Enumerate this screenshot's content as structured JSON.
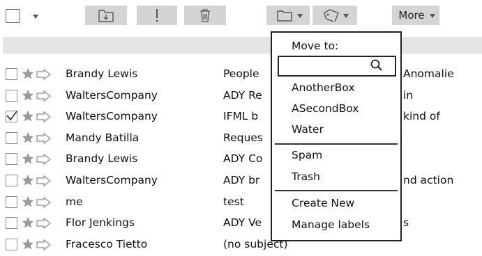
{
  "toolbar": {
    "more_label": "More",
    "icons": [
      "checkbox-icon",
      "move-to-folder-icon",
      "report-spam-icon",
      "trash-icon",
      "folder-icon",
      "label-tag-icon"
    ]
  },
  "move_menu": {
    "title": "Move to:",
    "search_placeholder": "",
    "items": [
      {
        "label": "AnotherBox"
      },
      {
        "label": "ASecondBox"
      },
      {
        "label": "Water"
      },
      {
        "label": "Spam"
      },
      {
        "label": "Trash"
      },
      {
        "label": "Create New"
      },
      {
        "label": "Manage labels"
      }
    ]
  },
  "messages": [
    {
      "sender": "Brandy Lewis",
      "subject": "People",
      "tail": "Anomalie",
      "checked": false
    },
    {
      "sender": "WaltersCompany",
      "subject": "ADY Re",
      "tail": "in",
      "checked": false
    },
    {
      "sender": "WaltersCompany",
      "subject": "IFML b",
      "tail": "kind of",
      "checked": true
    },
    {
      "sender": "Mandy Batilla",
      "subject": "Reques",
      "tail": "",
      "checked": false
    },
    {
      "sender": "Brandy Lewis",
      "subject": "ADY Co",
      "tail": "",
      "checked": false
    },
    {
      "sender": "WaltersCompany",
      "subject": "ADY br",
      "tail": "nd action",
      "checked": false
    },
    {
      "sender": "me",
      "subject": "test",
      "tail": "",
      "checked": false
    },
    {
      "sender": "Flor Jenkings",
      "subject": "ADY Ve",
      "tail": "s",
      "checked": false
    },
    {
      "sender": "Fracesco Tietto",
      "subject": "(no subject)",
      "tail": "",
      "checked": false
    }
  ],
  "colors": {
    "toolbar_button": "#d4d4d4",
    "band": "#e5e5e5",
    "star": "#9a9a9a"
  }
}
